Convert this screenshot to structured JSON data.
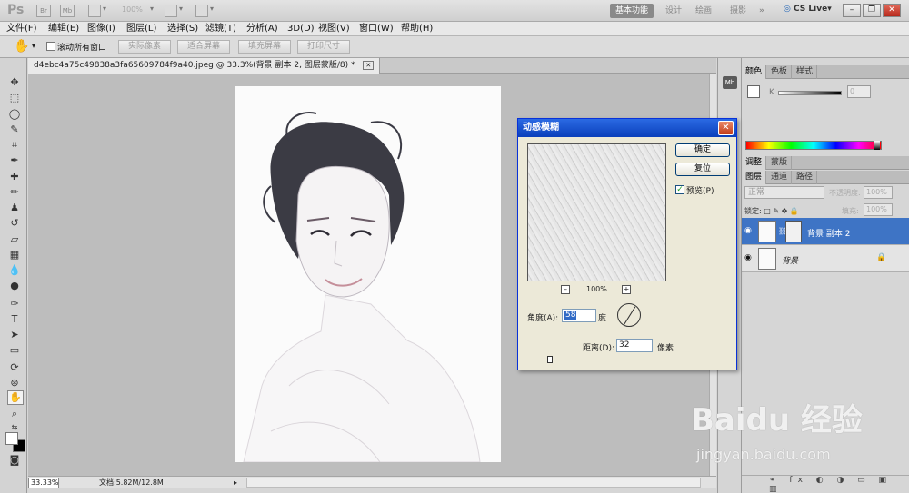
{
  "app": {
    "logo": "Ps",
    "icon_br": "Br",
    "icon_mb": "Mb",
    "zoom_level": "100%"
  },
  "workspaces": {
    "basic": "基本功能",
    "design": "设计",
    "paint": "绘画",
    "photo": "摄影",
    "more": "»",
    "cslive": "CS Live"
  },
  "menu": [
    "文件(F)",
    "编辑(E)",
    "图像(I)",
    "图层(L)",
    "选择(S)",
    "滤镜(T)",
    "分析(A)",
    "3D(D)",
    "视图(V)",
    "窗口(W)",
    "帮助(H)"
  ],
  "options": {
    "scroll_all_label": "滚动所有窗口",
    "actual_pixels": "实际像素",
    "fit_screen": "适合屏幕",
    "fill_screen": "填充屏幕",
    "print_size": "打印尺寸"
  },
  "document": {
    "tab_title": "d4ebc4a75c49838a3fa65609784f9a40.jpeg @ 33.3%(背景 副本 2, 图层蒙版/8) *",
    "zoom": "33.33%",
    "doc_size": "文档:5.82M/12.8M"
  },
  "panels": {
    "color_tabs": [
      "颜色",
      "色板",
      "样式"
    ],
    "k_label": "K",
    "k_value": "0",
    "adjust_tabs": [
      "调整",
      "蒙版"
    ],
    "layer_tabs": [
      "图层",
      "通道",
      "路径"
    ],
    "blend_mode": "正常",
    "opacity_label": "不透明度:",
    "opacity_value": "100%",
    "lock_label": "锁定:",
    "fill_label": "填充:",
    "fill_value": "100%",
    "layers": [
      {
        "name": "背景 副本 2"
      },
      {
        "name": "背景"
      }
    ],
    "footer_icons": "⚭ fx ◐ ◑ ▭ ▣ ▥"
  },
  "dialog": {
    "title": "动感模糊",
    "ok": "确定",
    "reset": "复位",
    "preview_label": "预览(P)",
    "preview_zoom": "100%",
    "angle_label": "角度(A):",
    "angle_value": "58",
    "angle_unit": "度",
    "distance_label": "距离(D):",
    "distance_value": "32",
    "distance_unit": "像素"
  },
  "watermark": {
    "text": "Baidu 经验",
    "url": "jingyan.baidu.com"
  },
  "colors": {
    "accent": "#3e74c5",
    "dialog_title": "#0a3fbb"
  }
}
